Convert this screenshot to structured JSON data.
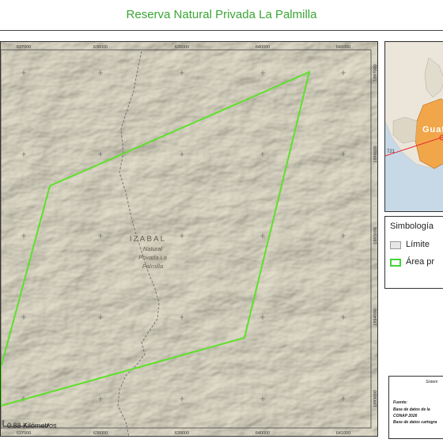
{
  "title": "Reserva Natural Privada La Palmilla",
  "map": {
    "x_ticks": [
      "637000",
      "638000",
      "639000",
      "640000",
      "641000"
    ],
    "y_ticks": [
      "1897000",
      "1896000",
      "1895000",
      "1894000",
      "1893000"
    ],
    "region_label": "IZABAL",
    "area_label_lines": [
      "Natural",
      "Privada La",
      "Palmilla"
    ],
    "scale_label": "0.88 Kilómetros",
    "polygon_color": "#5ee02a",
    "terrain_color": "#dcd7c3"
  },
  "inset": {
    "place_label": "Guate",
    "number_label": "721",
    "highlight_color": "#f2a64a"
  },
  "legend": {
    "title": "Simbología",
    "items": [
      {
        "label": "Límite",
        "fill": "#e6e6e6",
        "stroke": "#999999"
      },
      {
        "label": "Área pr",
        "fill": "#ffffff",
        "stroke": "#44d43a"
      }
    ]
  },
  "source": {
    "header": "Sistem",
    "fuente": "Fuente:",
    "line1": "Base de datos de la",
    "line2": "CONAP 2026",
    "line3": "Base de datos cartogra"
  }
}
